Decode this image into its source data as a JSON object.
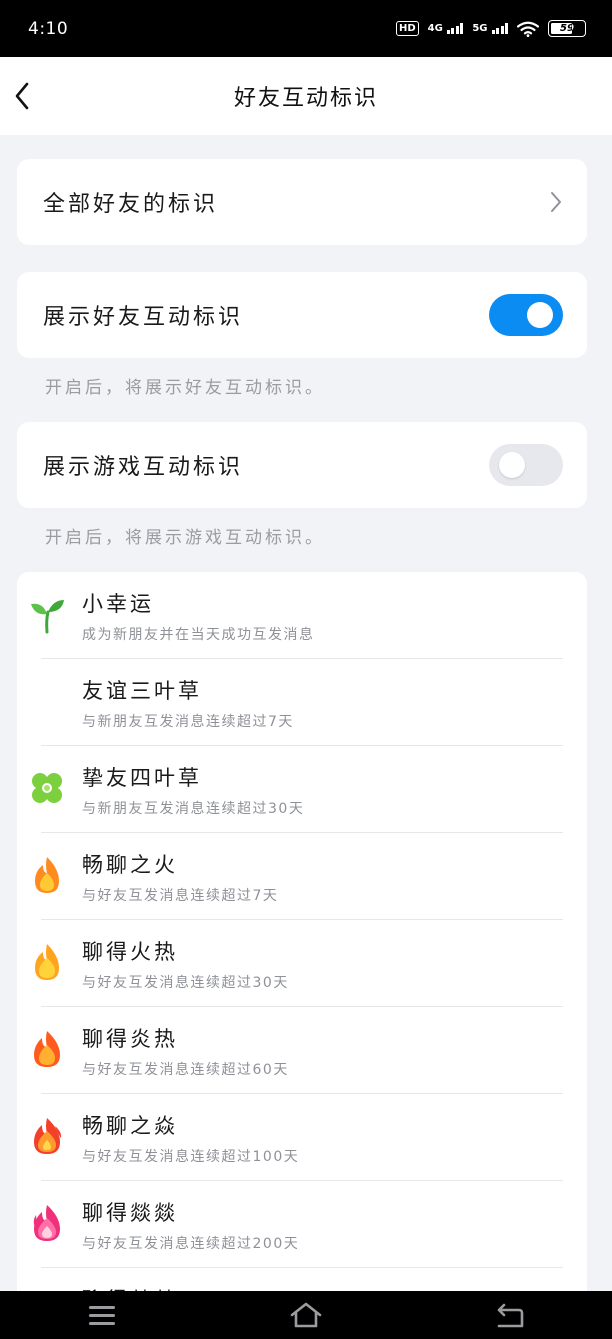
{
  "status_bar": {
    "time": "4:10",
    "hd": "HD",
    "sim1": "4G",
    "sim2": "5G",
    "battery": "59"
  },
  "header": {
    "title": "好友互动标识"
  },
  "all_badges_row": {
    "label": "全部好友的标识"
  },
  "friend_toggle": {
    "label": "展示好友互动标识",
    "enabled": true,
    "hint": "开启后，将展示好友互动标识。"
  },
  "game_toggle": {
    "label": "展示游戏互动标识",
    "enabled": false,
    "hint": "开启后，将展示游戏互动标识。"
  },
  "badges": [
    {
      "name": "小幸运",
      "desc": "成为新朋友并在当天成功互发消息",
      "icon": "sprout-icon"
    },
    {
      "name": "友谊三叶草",
      "desc": "与新朋友互发消息连续超过7天",
      "icon": "none"
    },
    {
      "name": "挚友四叶草",
      "desc": "与新朋友互发消息连续超过30天",
      "icon": "clover-icon"
    },
    {
      "name": "畅聊之火",
      "desc": "与好友互发消息连续超过7天",
      "icon": "flame-small-icon"
    },
    {
      "name": "聊得火热",
      "desc": "与好友互发消息连续超过30天",
      "icon": "flame-yellow-icon"
    },
    {
      "name": "聊得炎热",
      "desc": "与好友互发消息连续超过60天",
      "icon": "flame-orange-icon"
    },
    {
      "name": "畅聊之焱",
      "desc": "与好友互发消息连续超过100天",
      "icon": "flame-red-icon"
    },
    {
      "name": "聊得燚燚",
      "desc": "与好友互发消息连续超过200天",
      "icon": "flame-pink-icon"
    },
    {
      "name": "聊得燚燚",
      "desc": "",
      "icon": "none"
    }
  ],
  "colors": {
    "accent": "#0b8cf2",
    "background": "#f2f3f7"
  }
}
